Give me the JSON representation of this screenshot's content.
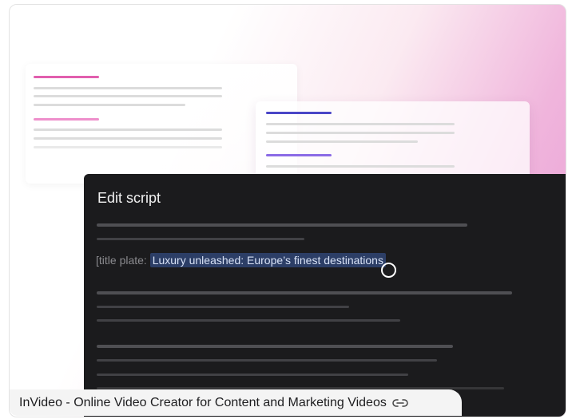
{
  "panel": {
    "title": "Edit script",
    "line_prefix": "[title plate: ",
    "highlight": "Luxury unleashed: Europe’s finest destinations"
  },
  "caption": {
    "text": "InVideo - Online Video Creator for Content and Marketing Videos",
    "icon": "link-icon"
  },
  "colors": {
    "accent_pink": "#e15fae",
    "accent_blue": "#4a46c7",
    "accent_violet": "#8b6be6",
    "panel_bg": "#1b1b1d",
    "highlight_bg": "#2c3e66"
  }
}
